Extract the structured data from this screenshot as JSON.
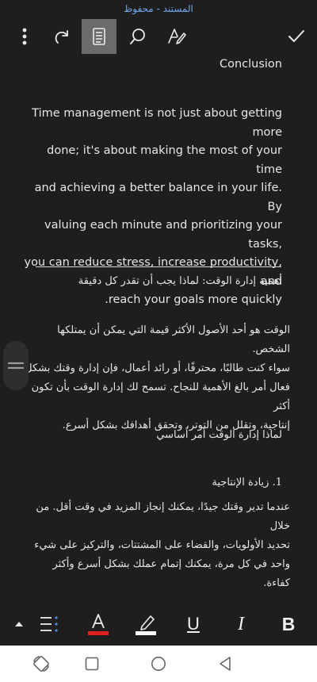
{
  "status": {
    "title": "المستند - محفوظ"
  },
  "toolbar": {
    "buttons": [
      {
        "name": "more-options",
        "icon": "more-vertical-icon"
      },
      {
        "name": "redo",
        "icon": "redo-icon"
      },
      {
        "name": "reading-view",
        "icon": "document-view-icon",
        "active": true
      },
      {
        "name": "find",
        "icon": "search-icon"
      },
      {
        "name": "draw",
        "icon": "pen-draw-icon"
      },
      {
        "name": "done",
        "icon": "checkmark-icon"
      }
    ]
  },
  "document": {
    "heading_en": "Conclusion",
    "paragraph_en": [
      "Time management is not just about getting more",
      "done; it's about making the most of your time",
      "and achieving a better balance in your life. By",
      "valuing each minute and prioritizing your tasks,",
      "you can reduce stress, increase productivity, and",
      ".reach your goals more quickly"
    ],
    "heading_ar": "أهمية إدارة الوقت: لماذا يجب أن تقدر كل دقيقة",
    "paragraph_ar": [
      "الوقت هو أحد الأصول الأكثر قيمة التي يمكن أن يمتلكها الشخص.",
      "سواء كنت طالبًا، محترفًا، أو رائد أعمال، فإن إدارة وقتك بشكل",
      "فعال أمر بالغ الأهمية للنجاح. تسمح لك إدارة الوقت بأن تكون أكثر",
      "إنتاجية، وتقلل من التوتر، وتحقق أهدافك بشكل أسرع."
    ],
    "subheading_ar": "لماذا إدارة الوقت أمر أساسي",
    "list_item_ar": "1. زيادة الإنتاجية",
    "list_paragraph_ar": [
      "عندما تدير وقتك جيدًا، يمكنك إنجاز المزيد في وقت أقل. من خلال",
      "تحديد الأولويات، والقضاء على المشتتات، والتركيز على شيء",
      "واحد في كل مرة، يمكنك إتمام عملك بشكل أسرع وأكثر كفاءة."
    ]
  },
  "format_bar": {
    "underline_label": "U",
    "italic_label": "I",
    "bold_label": "B",
    "font_color": "#e02020",
    "highlight_color": "#ffffff"
  }
}
